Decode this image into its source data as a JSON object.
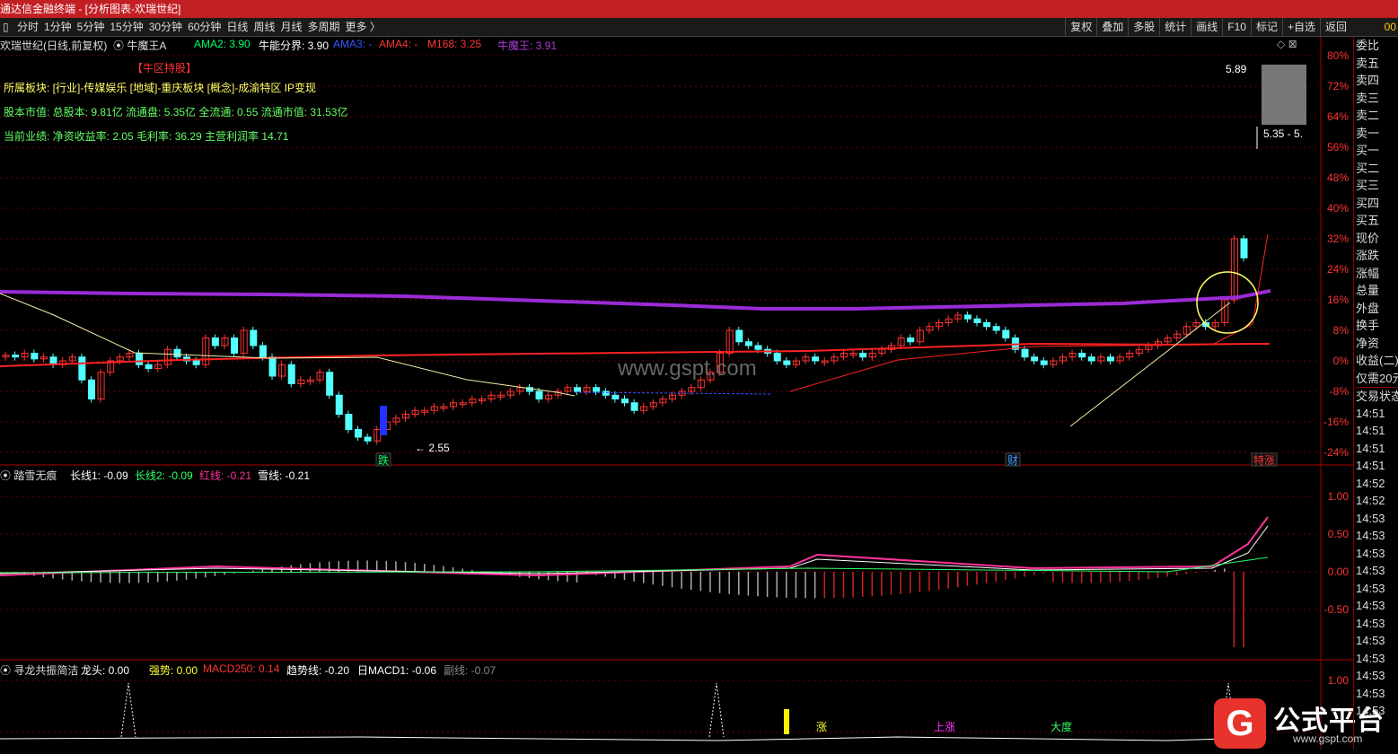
{
  "window_title": "通达信金融终端 - [分析图表-欢瑞世纪]",
  "toolbar": {
    "left_items": [
      "分时",
      "1分钟",
      "5分钟",
      "15分钟",
      "30分钟",
      "60分钟",
      "日线",
      "周线",
      "月线",
      "多周期",
      "更多 〉"
    ],
    "right_items": [
      "复权",
      "叠加",
      "多股",
      "统计",
      "画线",
      "F10",
      "标记",
      "+自选",
      "返回"
    ],
    "right_number": "00"
  },
  "chart_header": {
    "stock": "欢瑞世纪(日线,前复权)",
    "indicator_name": "牛魔王A",
    "ama2": "AMA2: 3.90",
    "niuneng": "牛能分界: 3.90",
    "ama3": "AMA3: -",
    "ama4": "AMA4: -",
    "m168": "M168: 3.25",
    "niumowang": "牛魔王: 3.91",
    "tag": "【牛区持股】",
    "sector": "所属板块: [行业]-传媒娱乐 [地域]-重庆板块 [概念]-成渝特区 IP变现",
    "capital": "股本市值: 总股本: 9.81亿 流通盘: 5.35亿 全流通: 0.55 流通市值: 31.53亿",
    "performance": "当前业绩: 净资收益率: 2.05 毛利率: 36.29 主营利润率 14.71"
  },
  "main_chart": {
    "y_axis_labels": [
      "80%",
      "72%",
      "64%",
      "56%",
      "48%",
      "40%",
      "32%",
      "24%",
      "16%",
      "8%",
      "0%",
      "-8%",
      "-16%",
      "-24%"
    ],
    "low_label": "2.55",
    "high_label": "5.89",
    "range_label": "5.35 - 5.",
    "markers": [
      "跌",
      "财",
      "特涨"
    ],
    "watermark": "www.gspt.com"
  },
  "indicator1": {
    "name": "踏雪无痕",
    "values": [
      "长线1: -0.09",
      "长线2: -0.09",
      "红线: -0.21",
      "雪线: -0.21"
    ],
    "y_axis_labels": [
      "1.00",
      "0.50",
      "0.00",
      "-0.50"
    ]
  },
  "indicator2": {
    "name": "寻龙共振简洁",
    "values": [
      "龙头: 0.00",
      "强势: 0.00",
      "MACD250: 0.14",
      "趋势线: -0.20",
      "日MACD1: -0.06",
      "副线: -0.07"
    ],
    "y_axis_labels": [
      "1.00"
    ],
    "labels": [
      "涨",
      "上涨",
      "大度"
    ]
  },
  "sidebar": {
    "items": [
      "委比",
      "卖五",
      "卖四",
      "卖三",
      "卖二",
      "卖一",
      "买一",
      "买二",
      "买三",
      "买四",
      "买五",
      "现价",
      "涨跌",
      "涨幅",
      "总量",
      "外盘",
      "换手",
      "净资",
      "收益(二)",
      "仅需20元",
      "交易状态",
      "14:51",
      "14:51",
      "14:51",
      "14:51",
      "14:52",
      "14:52",
      "14:53",
      "14:53",
      "14:53",
      "14:53",
      "14:53",
      "14:53",
      "14:53",
      "14:53",
      "14:53",
      "14:53",
      "14:53",
      "14:53"
    ]
  },
  "logo": {
    "text": "公式平台",
    "url": "www.gspt.com"
  },
  "colors": {
    "up": "#ff3333",
    "down": "#54ffff",
    "title_bg": "#c21f24",
    "purple": "#9a2bd6",
    "grid": "#8b0000"
  }
}
